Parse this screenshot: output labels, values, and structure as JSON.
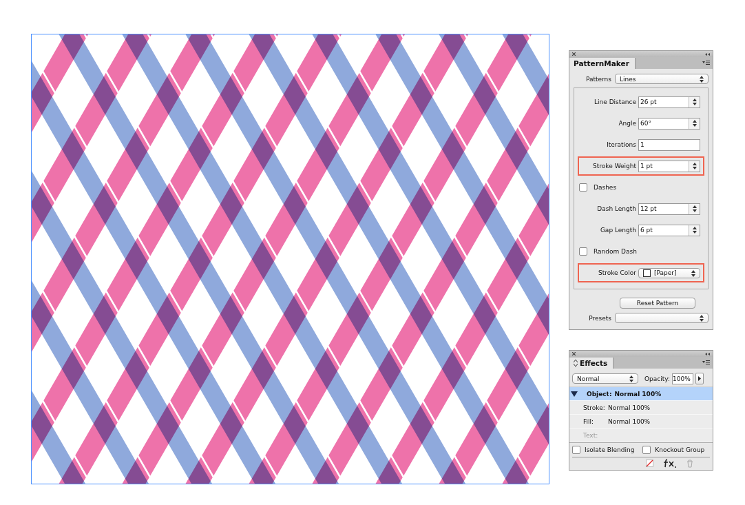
{
  "artwork": {
    "kind": "pattern"
  },
  "pattern_panel": {
    "title": "PatternMaker",
    "patterns": {
      "label": "Patterns",
      "value": "Lines"
    },
    "fields": [
      {
        "kind": "spinner",
        "label": "Line Distance",
        "value": "26 pt",
        "highlighted": false
      },
      {
        "kind": "spinner",
        "label": "Angle",
        "value": "60°",
        "highlighted": false
      },
      {
        "kind": "text",
        "label": "Iterations",
        "value": "1",
        "highlighted": false
      },
      {
        "kind": "spinner",
        "label": "Stroke Weight",
        "value": "1 pt",
        "highlighted": true
      },
      {
        "kind": "checkbox",
        "label": "Dashes",
        "checked": false,
        "highlighted": false
      },
      {
        "kind": "spinner",
        "label": "Dash Length",
        "value": "12 pt",
        "highlighted": false
      },
      {
        "kind": "spinner",
        "label": "Gap Length",
        "value": "6 pt",
        "highlighted": false
      },
      {
        "kind": "checkbox",
        "label": "Random Dash",
        "checked": false,
        "highlighted": false
      },
      {
        "kind": "color",
        "label": "Stroke Color",
        "value": "[Paper]",
        "highlighted": true
      }
    ],
    "reset_button": "Reset Pattern",
    "presets": {
      "label": "Presets"
    }
  },
  "effects_panel": {
    "title": "Effects",
    "blend_mode": "Normal",
    "opacity_label": "Opacity:",
    "opacity": "100%",
    "rows": [
      {
        "label": "Object:",
        "value": "Normal 100%",
        "selected": true,
        "disabled": false
      },
      {
        "label": "Stroke:",
        "value": "Normal 100%",
        "selected": false,
        "disabled": false
      },
      {
        "label": "Fill:",
        "value": "Normal 100%",
        "selected": false,
        "disabled": false
      },
      {
        "label": "Text:",
        "selected": false,
        "disabled": true
      }
    ],
    "options": [
      {
        "label": "Isolate Blending",
        "checked": false
      },
      {
        "label": "Knockout Group",
        "checked": false
      }
    ]
  }
}
